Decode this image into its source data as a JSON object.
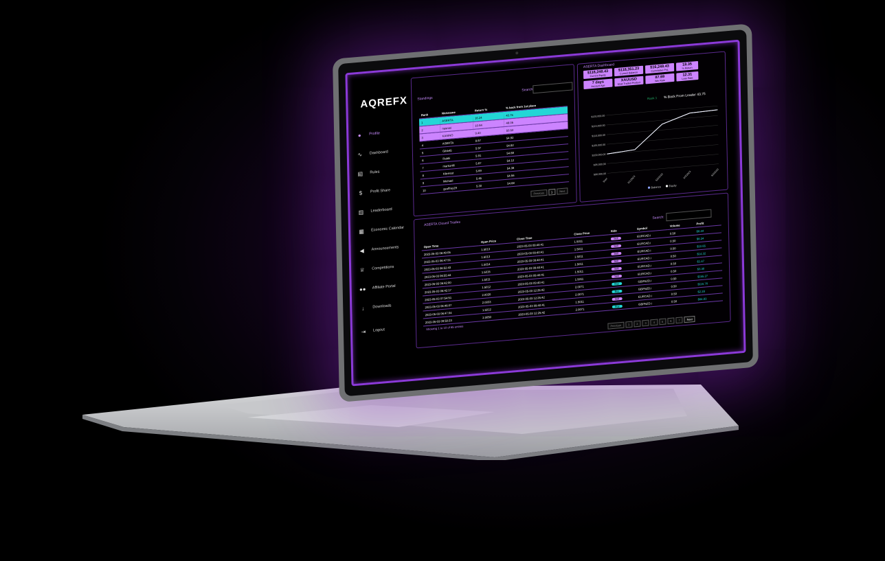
{
  "app": {
    "logo": "AQREFX"
  },
  "sidebar": {
    "items": [
      {
        "label": "Profile",
        "icon": "user-icon"
      },
      {
        "label": "Dashboard",
        "icon": "chart-icon"
      },
      {
        "label": "Rules",
        "icon": "document-icon"
      },
      {
        "label": "Profit Share",
        "icon": "dollar-icon"
      },
      {
        "label": "Leaderboard",
        "icon": "leaderboard-icon"
      },
      {
        "label": "Economic Calendar",
        "icon": "calendar-icon"
      },
      {
        "label": "Announcements",
        "icon": "megaphone-icon"
      },
      {
        "label": "Competitions",
        "icon": "trophy-icon"
      },
      {
        "label": "Affiliate Portal",
        "icon": "users-icon"
      },
      {
        "label": "Downloads",
        "icon": "download-icon"
      },
      {
        "label": "Logout",
        "icon": "logout-icon"
      }
    ]
  },
  "standings": {
    "title": "Standings",
    "search_label": "Search:",
    "columns": [
      "Rank",
      "Nickname",
      "Return %",
      "% back from 1st place"
    ],
    "rows": [
      [
        "1",
        "ASERTA",
        "16.24",
        "43.75"
      ],
      [
        "2",
        "nasrosi",
        "10.94",
        "48.05"
      ],
      [
        "3",
        "KASINO",
        "9.40",
        "50.53"
      ],
      [
        "4",
        "ASERTA",
        "8.87",
        "54.92"
      ],
      [
        "5",
        "Gibb45",
        "5.97",
        "54.82"
      ],
      [
        "6",
        "Rabbi",
        "5.91",
        "54.88"
      ],
      [
        "7",
        "markonfil",
        "5.87",
        "54.12"
      ],
      [
        "8",
        "Kilerrest",
        "5.69",
        "54.38"
      ],
      [
        "9",
        "Michael",
        "5.45",
        "54.56"
      ],
      [
        "10",
        "geoffrey29",
        "5.30",
        "54.68"
      ]
    ],
    "pager": {
      "prev": "Previous",
      "page": "1",
      "next": "Next"
    }
  },
  "dashboard": {
    "title": "ASERTA Dashboard",
    "stats": [
      {
        "value": "$116,248.43",
        "label": "Current Equity"
      },
      {
        "value": "$118,351.23",
        "label": "Current Balance"
      },
      {
        "value": "$16,248.43",
        "label": "Cumulative PnL"
      },
      {
        "value": "18.35",
        "label": "% Return"
      },
      {
        "value": "7 days",
        "label": "Account Age"
      },
      {
        "value": "XAUUSD",
        "label": "Most Traded Product"
      },
      {
        "value": "87.69",
        "label": "Win Rate"
      },
      {
        "value": "12.31",
        "label": "Loss Rate"
      }
    ],
    "back_from_leader_label": "% Back From Leader",
    "back_from_leader_value": "43.75",
    "rank_label": "Rank 1"
  },
  "chart_data": {
    "type": "line",
    "x": [
      "Start",
      "5/1/2023",
      "5/2/2023",
      "5/3/2023",
      "5/4/2023"
    ],
    "series": [
      {
        "name": "Balance",
        "values": [
          100000,
          101000,
          113000,
          117500,
          118000
        ]
      },
      {
        "name": "Equity",
        "values": [
          100000,
          101000,
          113000,
          117500,
          118000
        ]
      }
    ],
    "ylim": [
      90000,
      122000
    ],
    "yticks": [
      "$90,000.00",
      "$95,000.00",
      "$100,000.00",
      "$105,000.00",
      "$110,000.00",
      "$115,000.00",
      "$120,000.00"
    ],
    "legend": "bottom"
  },
  "closed_trades": {
    "title": "ASERTA Closed Trades",
    "search_label": "Search:",
    "columns": [
      "Open Time",
      "Open Price",
      "Close Time",
      "Close Price",
      "Side",
      "Symbol",
      "Volume",
      "Profit"
    ],
    "rows": [
      [
        "2023-05-03 06:40:05",
        "1.5013",
        "2023-05-03 09:40:41",
        "1.5011",
        "Sell",
        "EURCAD.i",
        "0.50",
        "$8.44"
      ],
      [
        "2023-05-03 06:47:51",
        "1.5013",
        "2023-05-03 09:40:41",
        "1.5011",
        "Sell",
        "EURCAD.i",
        "0.50",
        "$6.24"
      ],
      [
        "2023-05-03 06:52:43",
        "1.5014",
        "2023-05-03 09:40:41",
        "1.5011",
        "Sell",
        "EURCAD.i",
        "0.50",
        "$10.65"
      ],
      [
        "2023-05-03 06:55:44",
        "1.5015",
        "2023-05-03 09:40:41",
        "1.5011",
        "Sell",
        "EURCAD.i",
        "0.50",
        "$14.32"
      ],
      [
        "2023-05-03 06:42:00",
        "1.5011",
        "2023-05-03 09:40:41",
        "1.5011",
        "Sell",
        "EURCAD.i",
        "0.50",
        "$1.47"
      ],
      [
        "2023-05-03 06:42:17",
        "1.5012",
        "2023-05-03 09:40:41",
        "1.5011",
        "Sell",
        "EURCAD.i",
        "0.50",
        "$3.30"
      ],
      [
        "2023-05-03 07:54:51",
        "2.0020",
        "2023-05-03 12:25:42",
        "2.0071",
        "Buy",
        "GBPNZD.i",
        "0.50",
        "$155.27"
      ],
      [
        "2023-05-03 06:46:07",
        "2.0033",
        "2023-05-03 12:25:42",
        "2.0071",
        "Buy",
        "GBPNZD.i",
        "0.50",
        "$116.76"
      ],
      [
        "2023-05-03 06:47:04",
        "1.5012",
        "2023-05-03 09:40:41",
        "1.5011",
        "Sell",
        "EURCAD.i",
        "0.50",
        "$2.28"
      ],
      [
        "2023-05-03 09:50:23",
        "2.0050",
        "2023-05-03 12:25:42",
        "2.0071",
        "Buy",
        "GBPNZD.i",
        "0.50",
        "$64.83"
      ]
    ],
    "footer": "Showing 1 to 10 of 65 entries",
    "pager": {
      "prev": "Previous",
      "pages": [
        "1",
        "2",
        "3",
        "4",
        "5",
        "6",
        "7"
      ],
      "next": "Next"
    }
  }
}
